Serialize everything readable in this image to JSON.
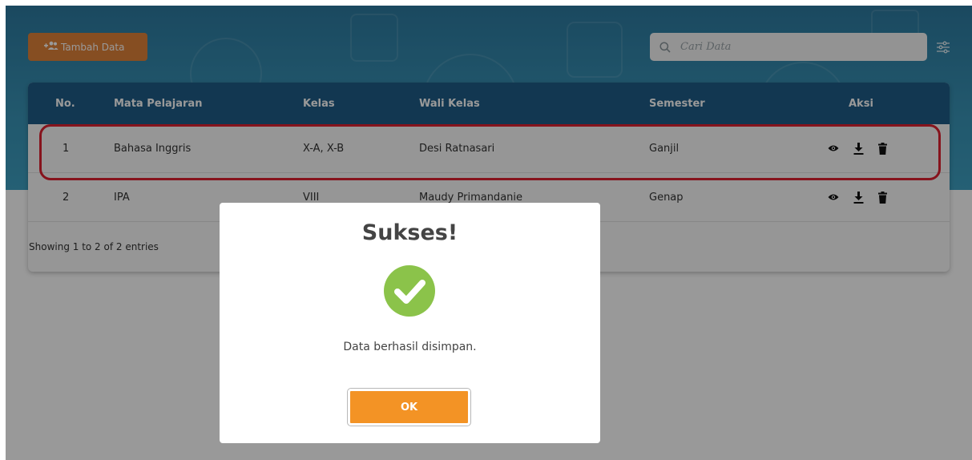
{
  "toolbar": {
    "add_label": "Tambah Data",
    "add_icon": "add-user-icon",
    "search_placeholder": "Cari Data",
    "filter_icon": "filter-sliders-icon"
  },
  "table": {
    "headers": [
      "No.",
      "Mata Pelajaran",
      "Kelas",
      "Wali Kelas",
      "Semester",
      "Aksi"
    ],
    "rows": [
      {
        "no": "1",
        "subject": "Bahasa Inggris",
        "class": "X-A, X-B",
        "teacher": "Desi Ratnasari",
        "semester": "Ganjil"
      },
      {
        "no": "2",
        "subject": "IPA",
        "class": "VIII",
        "teacher": "Maudy Primandanie",
        "semester": "Genap"
      }
    ],
    "footer": "Showing 1 to 2 of 2 entries",
    "action_icons": [
      "eye-icon",
      "download-icon",
      "trash-icon"
    ]
  },
  "modal": {
    "title": "Sukses!",
    "message": "Data berhasil disimpan.",
    "ok_label": "OK",
    "icon": "check-circle-icon"
  },
  "colors": {
    "header_band": "#3892b5",
    "table_header": "#1e5d87",
    "add_button": "#e0823a",
    "ok_button": "#f39325",
    "success": "#8bc34a",
    "highlight": "#e02030"
  }
}
